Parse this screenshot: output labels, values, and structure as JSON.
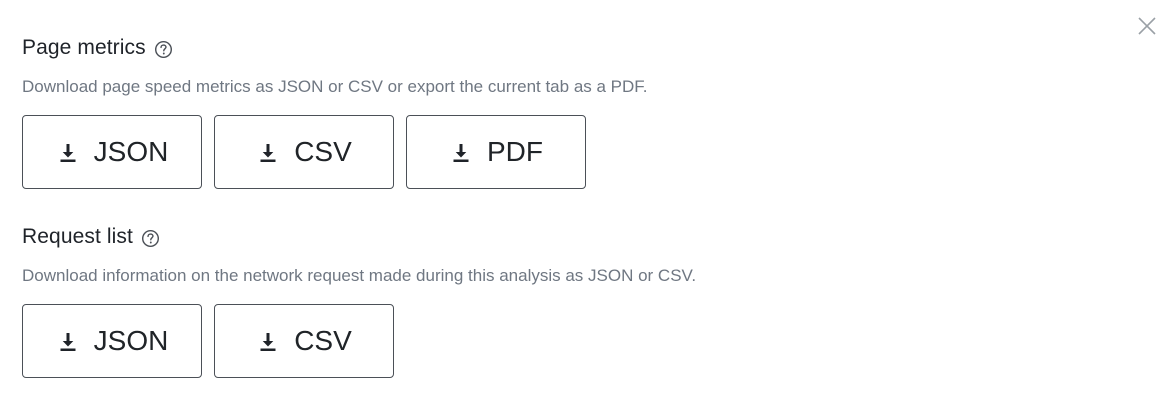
{
  "close_icon": "close-icon",
  "colors": {
    "text": "#1f2329",
    "description": "#6f7782",
    "button_border": "#4b5057",
    "icon": "#1f2329"
  },
  "page_metrics": {
    "title": "Page metrics",
    "help_icon": "help-circle-icon",
    "description": "Download page speed metrics as JSON or CSV or export the current tab as a PDF.",
    "buttons": [
      {
        "label": "JSON",
        "icon": "download-icon"
      },
      {
        "label": "CSV",
        "icon": "download-icon"
      },
      {
        "label": "PDF",
        "icon": "download-icon"
      }
    ]
  },
  "request_list": {
    "title": "Request list",
    "help_icon": "help-circle-icon",
    "description": "Download information on the network request made during this analysis as JSON or CSV.",
    "buttons": [
      {
        "label": "JSON",
        "icon": "download-icon"
      },
      {
        "label": "CSV",
        "icon": "download-icon"
      }
    ]
  }
}
